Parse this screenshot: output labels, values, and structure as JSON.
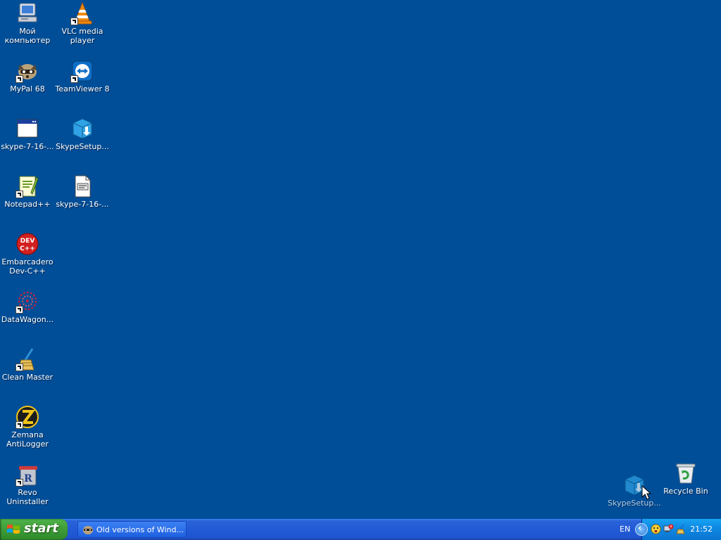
{
  "desktop": {
    "icons": {
      "my_computer": "Мой компьютер",
      "vlc": "VLC media player",
      "mypal": "MyPal 68",
      "teamviewer": "TeamViewer 8",
      "skype_exe1": "skype-7-16-...",
      "skypesetup1": "SkypeSetup...",
      "notepadpp": "Notepad++",
      "skype_exe2": "skype-7-16-...",
      "devcpp": "Embarcadero Dev-C++",
      "datawagon": "DataWagon...",
      "cleanmaster": "Clean Master",
      "zemana": "Zemana AntiLogger",
      "revo": "Revo Uninstaller",
      "skypesetup_drag": "SkypeSetup...",
      "recycle": "Recycle Bin"
    }
  },
  "taskbar": {
    "start_label": "start",
    "tasks": [
      {
        "label": "Old versions of Wind...",
        "icon": "browser-raccoon-icon"
      }
    ],
    "tray": {
      "language": "EN",
      "clock": "21:52",
      "icons": [
        "show-hidden-icons-icon",
        "smiley-alert-icon",
        "network-alert-icon",
        "cleaner-icon"
      ]
    }
  },
  "colors": {
    "desktop_bg": "#004e98",
    "taskbar_blue": "#225ad6",
    "start_green": "#3f9c38",
    "tray_blue": "#0e8ae4"
  }
}
